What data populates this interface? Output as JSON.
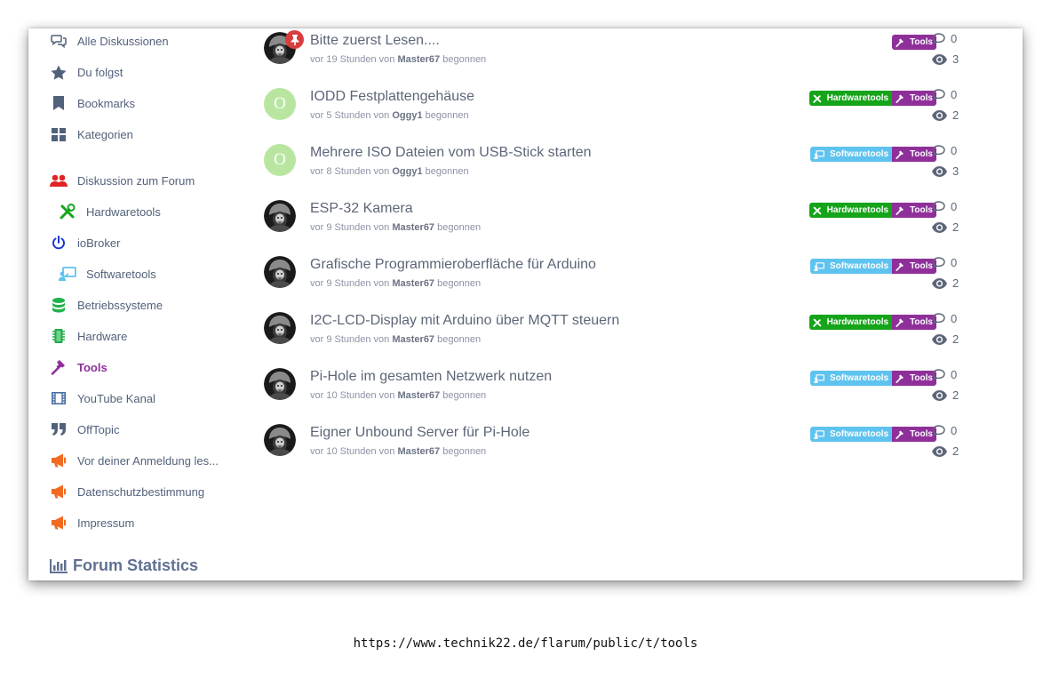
{
  "sidebar": {
    "items": [
      {
        "label": "Alle Diskussionen",
        "icon": "comments-icon",
        "color": "#52617a"
      },
      {
        "label": "Du folgst",
        "icon": "star-icon",
        "color": "#52617a"
      },
      {
        "label": "Bookmarks",
        "icon": "bookmark-icon",
        "color": "#52617a"
      },
      {
        "label": "Kategorien",
        "icon": "grid-icon",
        "color": "#52617a"
      },
      {
        "label": "Diskussion zum Forum",
        "icon": "users-icon",
        "color": "#e02424"
      },
      {
        "label": "Hardwaretools",
        "icon": "tools-icon",
        "color": "#15a41a"
      },
      {
        "label": "ioBroker",
        "icon": "power-icon",
        "color": "#1b34d8"
      },
      {
        "label": "Softwaretools",
        "icon": "chalkboard-icon",
        "color": "#5ec3ee"
      },
      {
        "label": "Betriebssysteme",
        "icon": "database-icon",
        "color": "#22b14c"
      },
      {
        "label": "Hardware",
        "icon": "chip-icon",
        "color": "#22a84a"
      },
      {
        "label": "Tools",
        "icon": "hammer-icon",
        "color": "#8e2f9a"
      },
      {
        "label": "YouTube Kanal",
        "icon": "film-icon",
        "color": "#4a6fa5"
      },
      {
        "label": "OffTopic",
        "icon": "quote-icon",
        "color": "#52617a"
      },
      {
        "label": "Vor deiner Anmeldung les...",
        "icon": "megaphone-icon",
        "color": "#f26a22"
      },
      {
        "label": "Datenschutzbestimmung",
        "icon": "megaphone-icon",
        "color": "#f26a22"
      },
      {
        "label": "Impressum",
        "icon": "megaphone-icon",
        "color": "#f26a22"
      }
    ],
    "stats_title": "Forum Statistics"
  },
  "discussions": [
    {
      "title": "Bitte zuerst Lesen....",
      "time": "vor 19 Stunden von",
      "author": "Master67",
      "suffix": "begonnen",
      "tags": [
        "Tools"
      ],
      "replies": "0",
      "views": "3",
      "avatar": "image",
      "pinned": true
    },
    {
      "title": "IODD Festplattengehäuse",
      "time": "vor 5 Stunden von",
      "author": "Oggy1",
      "suffix": "begonnen",
      "tags": [
        "Hardwaretools",
        "Tools"
      ],
      "replies": "0",
      "views": "2",
      "avatar": "O"
    },
    {
      "title": "Mehrere ISO Dateien vom USB-Stick starten",
      "time": "vor 8 Stunden von",
      "author": "Oggy1",
      "suffix": "begonnen",
      "tags": [
        "Softwaretools",
        "Tools"
      ],
      "replies": "0",
      "views": "3",
      "avatar": "O"
    },
    {
      "title": "ESP-32 Kamera",
      "time": "vor 9 Stunden von",
      "author": "Master67",
      "suffix": "begonnen",
      "tags": [
        "Hardwaretools",
        "Tools"
      ],
      "replies": "0",
      "views": "2",
      "avatar": "image"
    },
    {
      "title": "Grafische Programmieroberfläche für Arduino",
      "time": "vor 9 Stunden von",
      "author": "Master67",
      "suffix": "begonnen",
      "tags": [
        "Softwaretools",
        "Tools"
      ],
      "replies": "0",
      "views": "2",
      "avatar": "image"
    },
    {
      "title": "I2C-LCD-Display mit Arduino über MQTT steuern",
      "time": "vor 9 Stunden von",
      "author": "Master67",
      "suffix": "begonnen",
      "tags": [
        "Hardwaretools",
        "Tools"
      ],
      "replies": "0",
      "views": "2",
      "avatar": "image"
    },
    {
      "title": "Pi-Hole im gesamten Netzwerk nutzen",
      "time": "vor 10 Stunden von",
      "author": "Master67",
      "suffix": "begonnen",
      "tags": [
        "Softwaretools",
        "Tools"
      ],
      "replies": "0",
      "views": "2",
      "avatar": "image"
    },
    {
      "title": "Eigner Unbound Server für Pi-Hole",
      "time": "vor 10 Stunden von",
      "author": "Master67",
      "suffix": "begonnen",
      "tags": [
        "Softwaretools",
        "Tools"
      ],
      "replies": "0",
      "views": "2",
      "avatar": "image"
    }
  ],
  "url": "https://www.technik22.de/flarum/public/t/tools",
  "colors": {
    "tools": "#8e2f9a",
    "hardwaretools": "#15a41a",
    "softwaretools": "#5ec3ee"
  }
}
